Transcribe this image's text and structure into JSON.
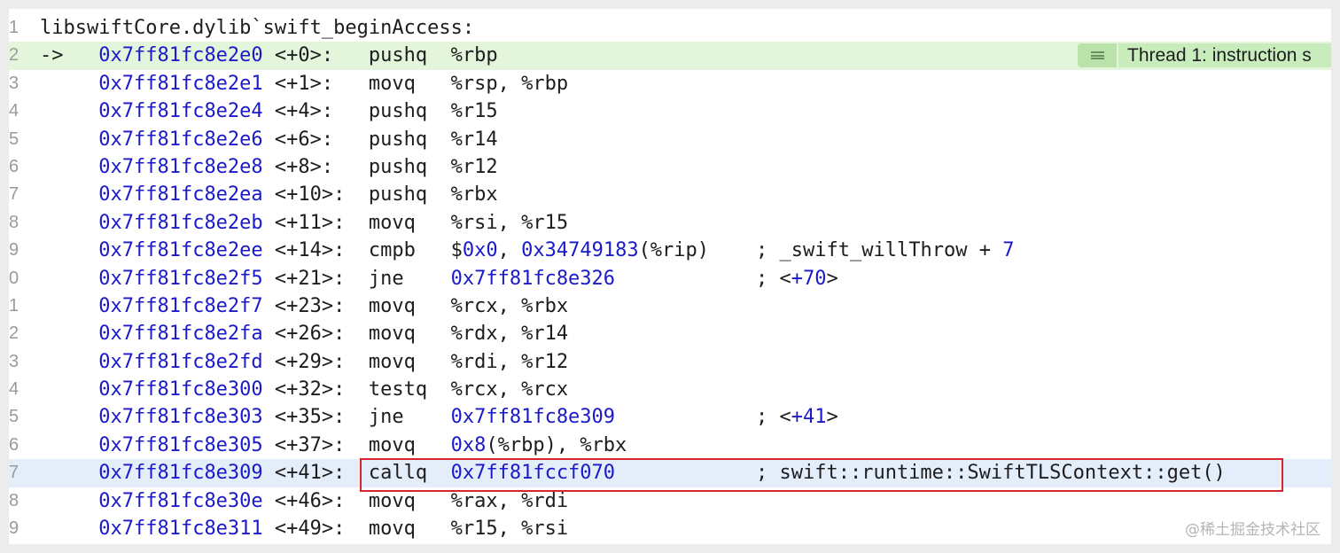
{
  "header": "libswiftCore.dylib`swift_beginAccess:",
  "pc_arrow": "->",
  "thread_badge": {
    "icon": "list-lines-icon",
    "text": "Thread 1: instruction s"
  },
  "lines": [
    {
      "ln": "2",
      "addr": "0x7ff81fc8e2e0",
      "off": "<+0>:",
      "op": "pushq",
      "pc": true,
      "args": [
        {
          "t": "%rbp"
        }
      ]
    },
    {
      "ln": "3",
      "addr": "0x7ff81fc8e2e1",
      "off": "<+1>:",
      "op": "movq",
      "args": [
        {
          "t": "%rsp, %rbp"
        }
      ]
    },
    {
      "ln": "4",
      "addr": "0x7ff81fc8e2e4",
      "off": "<+4>:",
      "op": "pushq",
      "args": [
        {
          "t": "%r15"
        }
      ]
    },
    {
      "ln": "5",
      "addr": "0x7ff81fc8e2e6",
      "off": "<+6>:",
      "op": "pushq",
      "args": [
        {
          "t": "%r14"
        }
      ]
    },
    {
      "ln": "6",
      "addr": "0x7ff81fc8e2e8",
      "off": "<+8>:",
      "op": "pushq",
      "args": [
        {
          "t": "%r12"
        }
      ]
    },
    {
      "ln": "7",
      "addr": "0x7ff81fc8e2ea",
      "off": "<+10>:",
      "op": "pushq",
      "args": [
        {
          "t": "%rbx"
        }
      ]
    },
    {
      "ln": "8",
      "addr": "0x7ff81fc8e2eb",
      "off": "<+11>:",
      "op": "movq",
      "args": [
        {
          "t": "%rsi, %r15"
        }
      ]
    },
    {
      "ln": "9",
      "addr": "0x7ff81fc8e2ee",
      "off": "<+14>:",
      "op": "cmpb",
      "args": [
        {
          "t": "$"
        },
        {
          "t": "0x0",
          "c": "num"
        },
        {
          "t": ", "
        },
        {
          "t": "0x34749183",
          "c": "num"
        },
        {
          "t": "(%rip)"
        }
      ],
      "cpad": 26,
      "comment": [
        {
          "t": "; _swift_willThrow + "
        },
        {
          "t": "7",
          "c": "num"
        }
      ]
    },
    {
      "ln": "0",
      "addr": "0x7ff81fc8e2f5",
      "off": "<+21>:",
      "op": "jne",
      "args": [
        {
          "t": "0x7ff81fc8e326",
          "c": "num"
        }
      ],
      "cpad": 26,
      "comment": [
        {
          "t": "; <"
        },
        {
          "t": "+70",
          "c": "num"
        },
        {
          "t": ">"
        }
      ]
    },
    {
      "ln": "1",
      "addr": "0x7ff81fc8e2f7",
      "off": "<+23>:",
      "op": "movq",
      "args": [
        {
          "t": "%rcx, %rbx"
        }
      ]
    },
    {
      "ln": "2",
      "addr": "0x7ff81fc8e2fa",
      "off": "<+26>:",
      "op": "movq",
      "args": [
        {
          "t": "%rdx, %r14"
        }
      ]
    },
    {
      "ln": "3",
      "addr": "0x7ff81fc8e2fd",
      "off": "<+29>:",
      "op": "movq",
      "args": [
        {
          "t": "%rdi, %r12"
        }
      ]
    },
    {
      "ln": "4",
      "addr": "0x7ff81fc8e300",
      "off": "<+32>:",
      "op": "testq",
      "args": [
        {
          "t": "%rcx, %rcx"
        }
      ]
    },
    {
      "ln": "5",
      "addr": "0x7ff81fc8e303",
      "off": "<+35>:",
      "op": "jne",
      "args": [
        {
          "t": "0x7ff81fc8e309",
          "c": "num"
        }
      ],
      "cpad": 26,
      "comment": [
        {
          "t": "; <"
        },
        {
          "t": "+41",
          "c": "num"
        },
        {
          "t": ">"
        }
      ]
    },
    {
      "ln": "6",
      "addr": "0x7ff81fc8e305",
      "off": "<+37>:",
      "op": "movq",
      "args": [
        {
          "t": "0x8",
          "c": "num"
        },
        {
          "t": "(%rbp), %rbx"
        }
      ]
    },
    {
      "ln": "7",
      "addr": "0x7ff81fc8e309",
      "off": "<+41>:",
      "op": "callq",
      "sel": true,
      "args": [
        {
          "t": "0x7ff81fccf070",
          "c": "num"
        }
      ],
      "cpad": 26,
      "comment": [
        {
          "t": "; swift::runtime::SwiftTLSContext::get()"
        }
      ]
    },
    {
      "ln": "8",
      "addr": "0x7ff81fc8e30e",
      "off": "<+46>:",
      "op": "movq",
      "args": [
        {
          "t": "%rax, %rdi"
        }
      ]
    },
    {
      "ln": "9",
      "addr": "0x7ff81fc8e311",
      "off": "<+49>:",
      "op": "movq",
      "args": [
        {
          "t": "%r15, %rsi"
        }
      ]
    }
  ],
  "header_ln": "1",
  "watermark": "@稀土掘金技术社区"
}
